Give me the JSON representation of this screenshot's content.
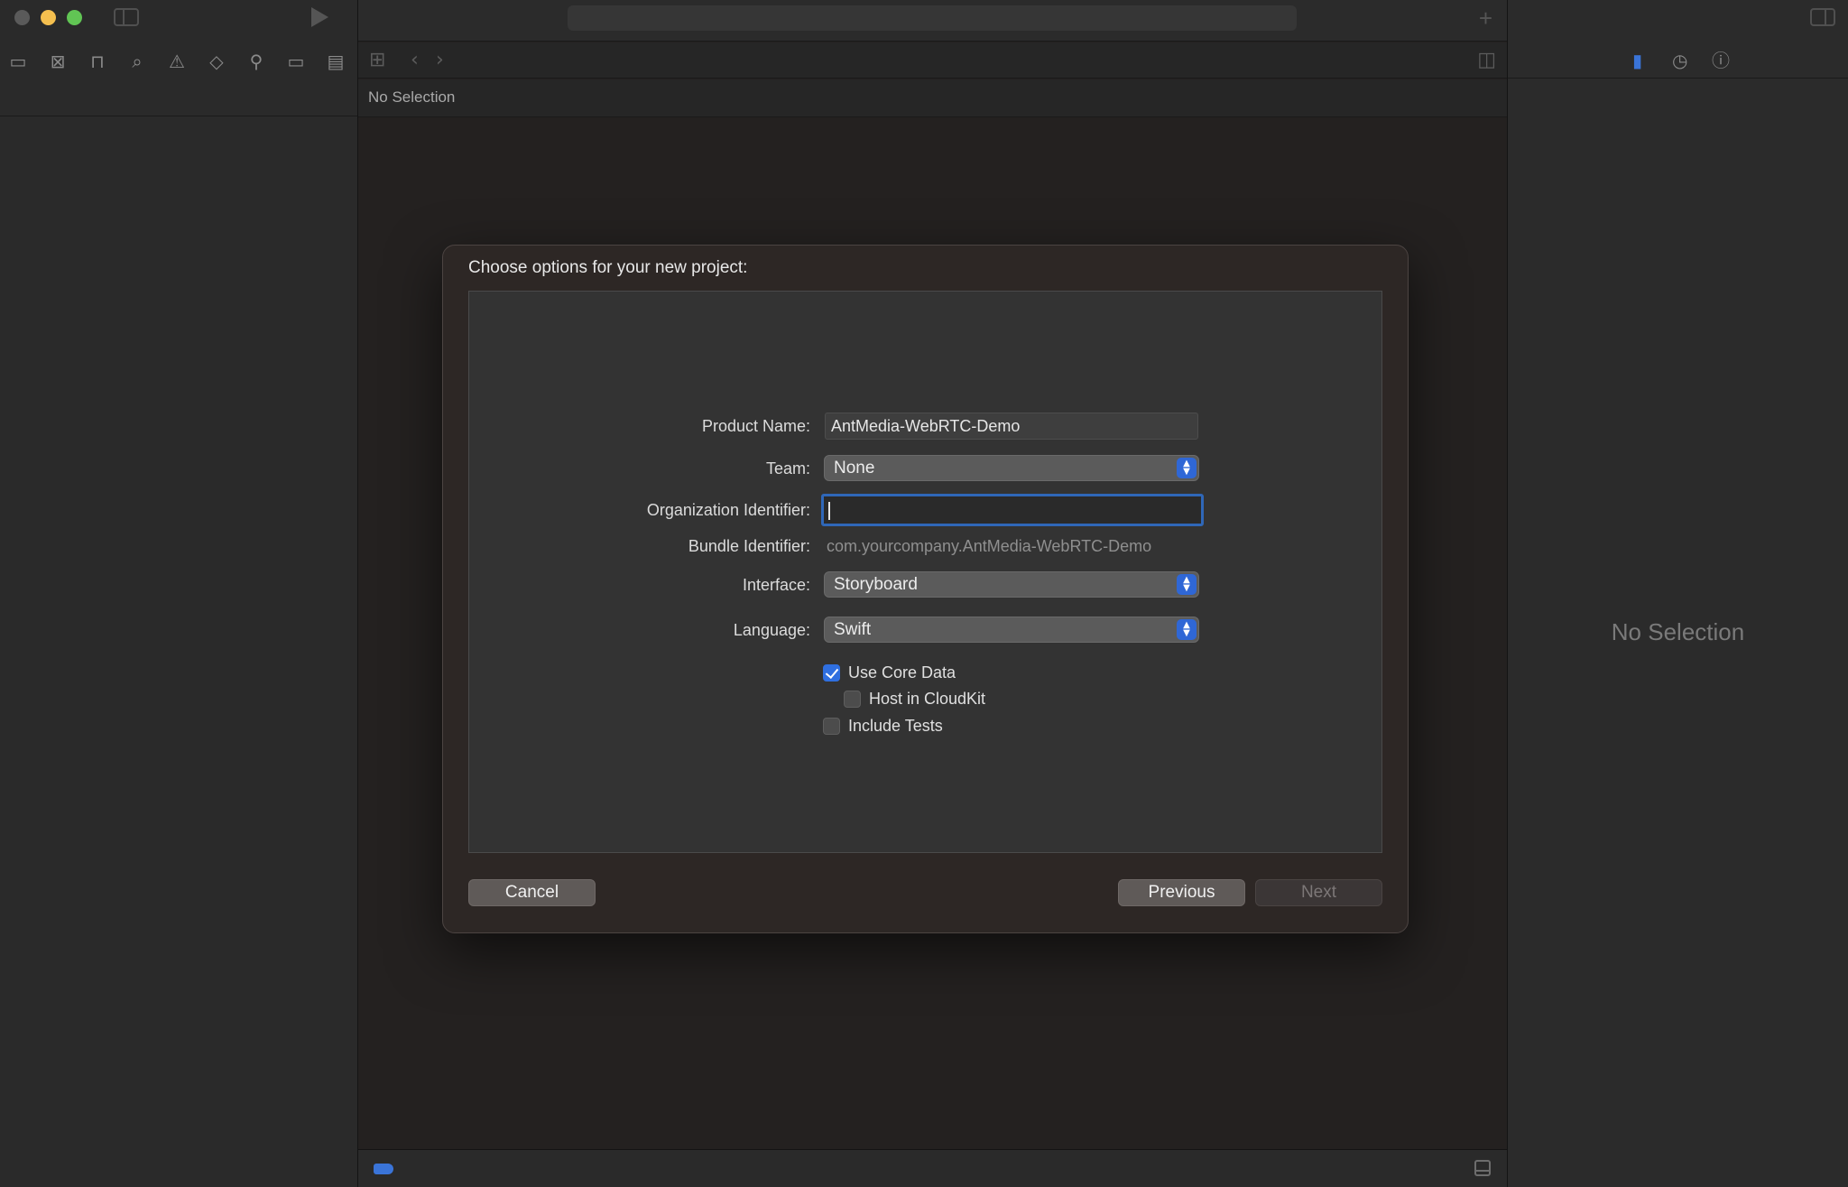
{
  "navigator": {
    "toolbar_icons": [
      "folder-icon",
      "source-control-icon",
      "symbol-icon",
      "search-icon",
      "warning-icon",
      "test-icon",
      "debug-icon",
      "breakpoint-icon",
      "report-icon"
    ]
  },
  "editor": {
    "jump_bar_text": "No Selection"
  },
  "inspector": {
    "empty_text": "No Selection",
    "tabs": [
      "file-inspector-icon",
      "history-icon",
      "help-icon"
    ]
  },
  "dialog": {
    "title": "Choose options for your new project:",
    "fields": {
      "product_name": {
        "label": "Product Name:",
        "value": "AntMedia-WebRTC-Demo"
      },
      "team": {
        "label": "Team:",
        "value": "None"
      },
      "organization_identifier": {
        "label": "Organization Identifier:",
        "value": ""
      },
      "bundle_identifier": {
        "label": "Bundle Identifier:",
        "value": "com.yourcompany.AntMedia-WebRTC-Demo"
      },
      "interface": {
        "label": "Interface:",
        "value": "Storyboard"
      },
      "language": {
        "label": "Language:",
        "value": "Swift"
      }
    },
    "checkboxes": {
      "use_core_data": {
        "label": "Use Core Data",
        "checked": true
      },
      "host_in_cloudkit": {
        "label": "Host in CloudKit",
        "checked": false
      },
      "include_tests": {
        "label": "Include Tests",
        "checked": false
      }
    },
    "buttons": {
      "cancel": "Cancel",
      "previous": "Previous",
      "next": "Next"
    }
  },
  "colors": {
    "accent": "#2f6fe0",
    "traffic_minimize": "#f4bf4f",
    "traffic_maximize": "#61c554"
  }
}
